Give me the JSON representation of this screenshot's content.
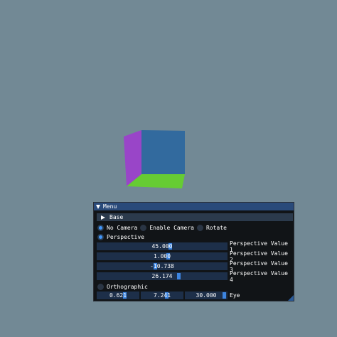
{
  "window": {
    "title": "Menu",
    "header": "Base",
    "camera_modes": [
      "No Camera",
      "Enable Camera",
      "Rotate"
    ],
    "selected_camera_mode": "No Camera",
    "projection_modes": [
      "Perspective",
      "Orthographic"
    ],
    "selected_projection": "Perspective",
    "perspective_sliders": [
      {
        "value": "45.000",
        "label": "Perspective Value 1"
      },
      {
        "value": "1.000",
        "label": "Perspective Value 2"
      },
      {
        "value": "-10.738",
        "label": "Perspective Value 3"
      },
      {
        "value": "26.174",
        "label": "Perspective Value 4"
      }
    ],
    "eye": {
      "values": [
        "0.621",
        "7.241",
        "30.000"
      ],
      "label": "Eye"
    }
  },
  "colors": {
    "background": "#728995",
    "cube_left": "#9945c8",
    "cube_front": "#326a9e",
    "cube_bottom": "#66cc33",
    "accent": "#4296fa"
  }
}
